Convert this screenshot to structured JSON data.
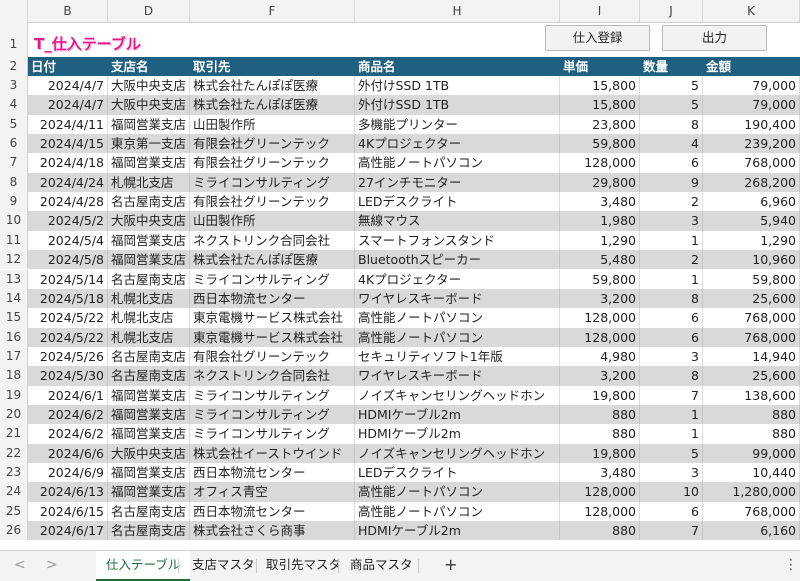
{
  "columns": [
    "B",
    "D",
    "F",
    "H",
    "I",
    "J",
    "K"
  ],
  "title": "T_仕入テーブル",
  "buttons": {
    "register": "仕入登録",
    "output": "出力"
  },
  "headers": [
    "日付",
    "支店名",
    "取引先",
    "商品名",
    "単価",
    "数量",
    "金額"
  ],
  "rows": [
    [
      "2024/4/7",
      "大阪中央支店",
      "株式会社たんぽぽ医療",
      "外付けSSD 1TB",
      "15,800",
      "5",
      "79,000"
    ],
    [
      "2024/4/7",
      "大阪中央支店",
      "株式会社たんぽぽ医療",
      "外付けSSD 1TB",
      "15,800",
      "5",
      "79,000"
    ],
    [
      "2024/4/11",
      "福岡営業支店",
      "山田製作所",
      "多機能プリンター",
      "23,800",
      "8",
      "190,400"
    ],
    [
      "2024/4/15",
      "東京第一支店",
      "有限会社グリーンテック",
      "4Kプロジェクター",
      "59,800",
      "4",
      "239,200"
    ],
    [
      "2024/4/18",
      "福岡営業支店",
      "有限会社グリーンテック",
      "高性能ノートパソコン",
      "128,000",
      "6",
      "768,000"
    ],
    [
      "2024/4/24",
      "札幌北支店",
      "ミライコンサルティング",
      "27インチモニター",
      "29,800",
      "9",
      "268,200"
    ],
    [
      "2024/4/28",
      "名古屋南支店",
      "有限会社グリーンテック",
      "LEDデスクライト",
      "3,480",
      "2",
      "6,960"
    ],
    [
      "2024/5/2",
      "大阪中央支店",
      "山田製作所",
      "無線マウス",
      "1,980",
      "3",
      "5,940"
    ],
    [
      "2024/5/4",
      "福岡営業支店",
      "ネクストリンク合同会社",
      "スマートフォンスタンド",
      "1,290",
      "1",
      "1,290"
    ],
    [
      "2024/5/8",
      "福岡営業支店",
      "株式会社たんぽぽ医療",
      "Bluetoothスピーカー",
      "5,480",
      "2",
      "10,960"
    ],
    [
      "2024/5/14",
      "名古屋南支店",
      "ミライコンサルティング",
      "4Kプロジェクター",
      "59,800",
      "1",
      "59,800"
    ],
    [
      "2024/5/18",
      "札幌北支店",
      "西日本物流センター",
      "ワイヤレスキーボード",
      "3,200",
      "8",
      "25,600"
    ],
    [
      "2024/5/22",
      "札幌北支店",
      "東京電機サービス株式会社",
      "高性能ノートパソコン",
      "128,000",
      "6",
      "768,000"
    ],
    [
      "2024/5/22",
      "札幌北支店",
      "東京電機サービス株式会社",
      "高性能ノートパソコン",
      "128,000",
      "6",
      "768,000"
    ],
    [
      "2024/5/26",
      "名古屋南支店",
      "有限会社グリーンテック",
      "セキュリティソフト1年版",
      "4,980",
      "3",
      "14,940"
    ],
    [
      "2024/5/30",
      "名古屋南支店",
      "ネクストリンク合同会社",
      "ワイヤレスキーボード",
      "3,200",
      "8",
      "25,600"
    ],
    [
      "2024/6/1",
      "福岡営業支店",
      "ミライコンサルティング",
      "ノイズキャンセリングヘッドホン",
      "19,800",
      "7",
      "138,600"
    ],
    [
      "2024/6/2",
      "福岡営業支店",
      "ミライコンサルティング",
      "HDMIケーブル2m",
      "880",
      "1",
      "880"
    ],
    [
      "2024/6/2",
      "福岡営業支店",
      "ミライコンサルティング",
      "HDMIケーブル2m",
      "880",
      "1",
      "880"
    ],
    [
      "2024/6/6",
      "大阪中央支店",
      "株式会社イーストウインド",
      "ノイズキャンセリングヘッドホン",
      "19,800",
      "5",
      "99,000"
    ],
    [
      "2024/6/9",
      "福岡営業支店",
      "西日本物流センター",
      "LEDデスクライト",
      "3,480",
      "3",
      "10,440"
    ],
    [
      "2024/6/13",
      "福岡営業支店",
      "オフィス青空",
      "高性能ノートパソコン",
      "128,000",
      "10",
      "1,280,000"
    ],
    [
      "2024/6/15",
      "名古屋南支店",
      "西日本物流センター",
      "高性能ノートパソコン",
      "128,000",
      "6",
      "768,000"
    ],
    [
      "2024/6/17",
      "名古屋南支店",
      "株式会社さくら商事",
      "HDMIケーブル2m",
      "880",
      "7",
      "6,160"
    ]
  ],
  "row_numbers": [
    "1",
    "2",
    "3",
    "4",
    "5",
    "6",
    "7",
    "8",
    "9",
    "10",
    "11",
    "12",
    "13",
    "14",
    "15",
    "16",
    "17",
    "18",
    "19",
    "20",
    "21",
    "22",
    "23",
    "24",
    "25",
    "26"
  ],
  "tabs": [
    "仕入テーブル",
    "支店マスタ",
    "取引先マスタ",
    "商品マスタ"
  ],
  "add_sheet": "+",
  "nav": {
    "prev": "<",
    "next": ">",
    "more": "⋮"
  },
  "colors": {
    "header_bg": "#1f5f7f",
    "band": "#d9d9d9",
    "title": "#e8188c",
    "active_tab": "#1e6b3a"
  }
}
